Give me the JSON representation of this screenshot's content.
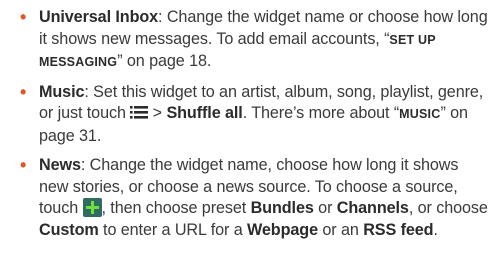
{
  "items": [
    {
      "term": "Universal Inbox",
      "text1": ": Change the widget name or choose how long it shows new messages. To add email accounts, “",
      "ref": "SET UP MESSAGING",
      "text2": "” on page 18."
    },
    {
      "term": "Music",
      "text1": ": Set this widget to an artist, album, song, playlist, genre, or just touch ",
      "icon": "menu-icon",
      "text2": " > ",
      "action": "Shuffle all",
      "text3": ". There’s more about “",
      "ref": "MUSIC",
      "text4": "” on page 31."
    },
    {
      "term": "News",
      "text1": ": Change the widget name, choose how long it shows new stories, or choose a news source. To choose a source, touch ",
      "icon": "plus-icon",
      "text2": ", then choose preset ",
      "opt1": "Bundles",
      "text3": " or ",
      "opt2": "Channels",
      "text4": ", or choose ",
      "opt3": "Custom",
      "text5": " to enter a URL for a ",
      "opt4": "Webpage",
      "text6": " or an ",
      "opt5": "RSS feed",
      "text7": "."
    }
  ],
  "colors": {
    "bullet": "#e2542b",
    "text": "#3a3a3a",
    "plus_icon_bg": "#2f6b63",
    "plus_icon_fg": "#6ee03a"
  }
}
